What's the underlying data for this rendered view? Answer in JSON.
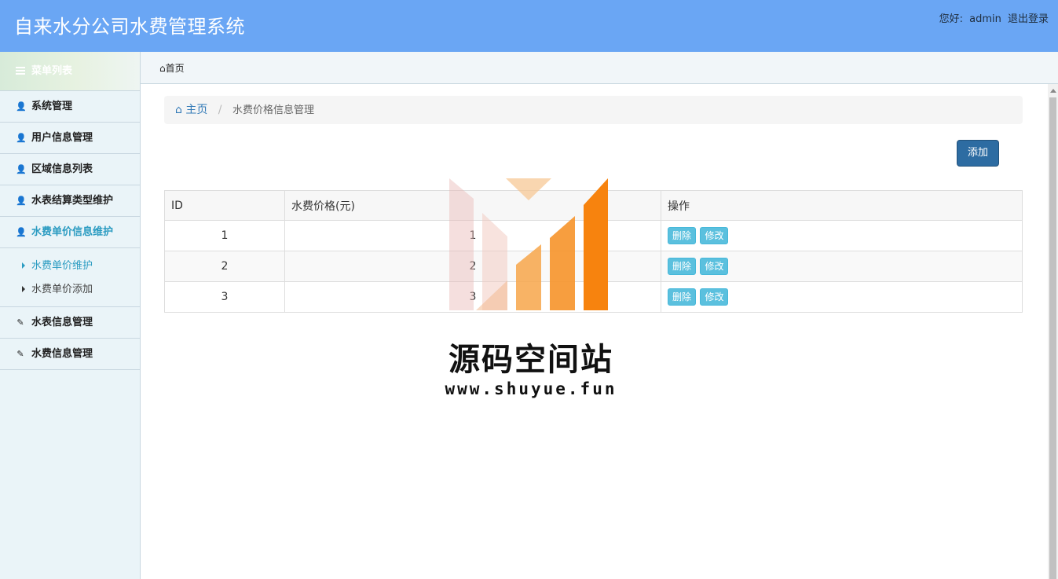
{
  "header": {
    "app_title": "自来水分公司水费管理系统",
    "greeting": "您好:",
    "username": "admin",
    "logout_label": "退出登录",
    "bg_color": "#6aa6f4"
  },
  "sidebar": {
    "menu_title": "菜单列表",
    "items": [
      {
        "label": "系统管理",
        "icon": "user-icon"
      },
      {
        "label": "用户信息管理",
        "icon": "user-icon"
      },
      {
        "label": "区域信息列表",
        "icon": "user-icon"
      },
      {
        "label": "水表结算类型维护",
        "icon": "user-icon"
      },
      {
        "label": "水费单价信息维护",
        "icon": "user-icon",
        "active": true
      },
      {
        "label": "水表信息管理",
        "icon": "edit-icon"
      },
      {
        "label": "水费信息管理",
        "icon": "edit-icon"
      }
    ],
    "subitems": [
      {
        "label": "水费单价维护",
        "active": true
      },
      {
        "label": "水费单价添加"
      }
    ]
  },
  "tabbar": {
    "home_tab": "首页"
  },
  "breadcrumb": {
    "home": "主页",
    "current": "水费价格信息管理"
  },
  "toolbar": {
    "add_label": "添加",
    "add_color": "#2d6ca2"
  },
  "table": {
    "columns": [
      "ID",
      "水费价格(元)",
      "操作"
    ],
    "rows": [
      {
        "id": "1",
        "price": "1"
      },
      {
        "id": "2",
        "price": "2"
      },
      {
        "id": "3",
        "price": "3"
      }
    ],
    "delete_label": "删除",
    "edit_label": "修改",
    "button_color": "#5bc0de"
  },
  "watermark": {
    "text": "源码空间站",
    "url": "www.shuyue.fun"
  }
}
